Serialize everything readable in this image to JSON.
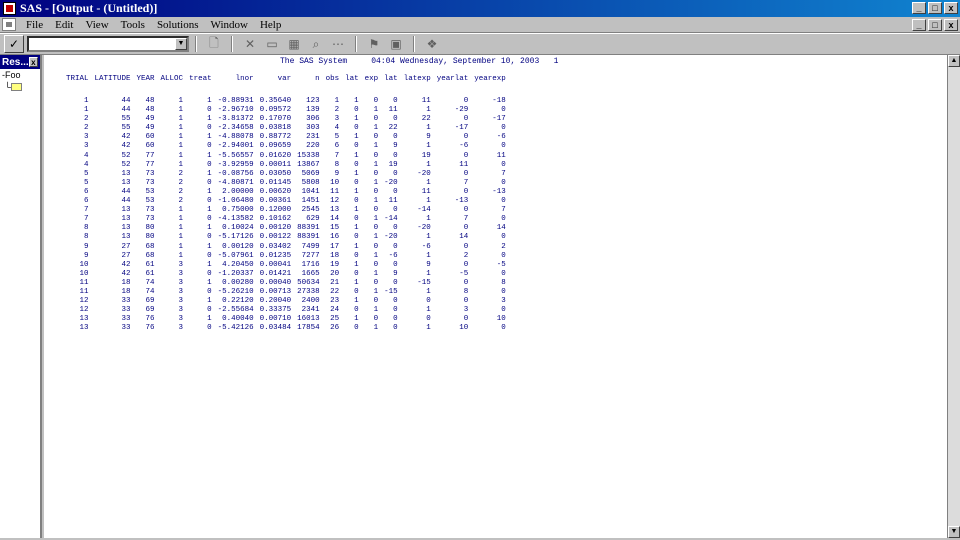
{
  "window": {
    "title": "SAS - [Output - (Untitled)]",
    "buttons": [
      "_",
      "□",
      "x"
    ]
  },
  "menu": {
    "items": [
      "File",
      "Edit",
      "View",
      "Tools",
      "Solutions",
      "Window",
      "Help"
    ],
    "mdi_buttons": [
      "_",
      "□",
      "x"
    ]
  },
  "toolbar": {
    "check_label": "✓",
    "command_value": ""
  },
  "results_pane": {
    "title": "Res...",
    "close": "x",
    "tree_item": "Foo"
  },
  "output": {
    "header": "The SAS System     04:04 Wednesday, September 10, 2003   1",
    "columns": [
      "TRIAL",
      "LATITUDE",
      "YEAR",
      "ALLOC",
      "treat",
      "lnor",
      "var",
      "n",
      "obs",
      "lat",
      "exp",
      "lat",
      "latexp",
      "yearlat",
      "yearexp"
    ],
    "rows": [
      [
        "1",
        "44",
        "48",
        "1",
        "1",
        "-0.88931",
        "0.35640",
        "123",
        "1",
        "1",
        "0",
        "0",
        "11",
        "0",
        "-18"
      ],
      [
        "1",
        "44",
        "48",
        "1",
        "0",
        "-2.96710",
        "0.09572",
        "139",
        "2",
        "0",
        "1",
        "11",
        "1",
        "-29",
        "0"
      ],
      [
        "2",
        "55",
        "49",
        "1",
        "1",
        "-3.81372",
        "0.17070",
        "306",
        "3",
        "1",
        "0",
        "0",
        "22",
        "0",
        "-17"
      ],
      [
        "2",
        "55",
        "49",
        "1",
        "0",
        "-2.34658",
        "0.03818",
        "303",
        "4",
        "0",
        "1",
        "22",
        "1",
        "-17",
        "0"
      ],
      [
        "3",
        "42",
        "60",
        "1",
        "1",
        "-4.88078",
        "0.88772",
        "231",
        "5",
        "1",
        "0",
        "0",
        "9",
        "0",
        "-6"
      ],
      [
        "3",
        "42",
        "60",
        "1",
        "0",
        "-2.94001",
        "0.09659",
        "220",
        "6",
        "0",
        "1",
        "9",
        "1",
        "-6",
        "0"
      ],
      [
        "4",
        "52",
        "77",
        "1",
        "1",
        "-5.56557",
        "0.01620",
        "15338",
        "7",
        "1",
        "0",
        "0",
        "19",
        "0",
        "11"
      ],
      [
        "4",
        "52",
        "77",
        "1",
        "0",
        "-3.92959",
        "0.00011",
        "13867",
        "8",
        "0",
        "1",
        "19",
        "1",
        "11",
        "0"
      ],
      [
        "5",
        "13",
        "73",
        "2",
        "1",
        "-0.08756",
        "0.03050",
        "5069",
        "9",
        "1",
        "0",
        "0",
        "-20",
        "0",
        "7"
      ],
      [
        "5",
        "13",
        "73",
        "2",
        "0",
        "-4.80871",
        "0.01145",
        "5808",
        "10",
        "0",
        "1",
        "-20",
        "1",
        "7",
        "0"
      ],
      [
        "6",
        "44",
        "53",
        "2",
        "1",
        "2.00000",
        "0.00620",
        "1041",
        "11",
        "1",
        "0",
        "0",
        "11",
        "0",
        "-13"
      ],
      [
        "6",
        "44",
        "53",
        "2",
        "0",
        "-1.06480",
        "0.00361",
        "1451",
        "12",
        "0",
        "1",
        "11",
        "1",
        "-13",
        "0"
      ],
      [
        "7",
        "13",
        "73",
        "1",
        "1",
        "0.75000",
        "0.12000",
        "2545",
        "13",
        "1",
        "0",
        "0",
        "-14",
        "0",
        "7"
      ],
      [
        "7",
        "13",
        "73",
        "1",
        "0",
        "-4.13582",
        "0.10162",
        "629",
        "14",
        "0",
        "1",
        "-14",
        "1",
        "7",
        "0"
      ],
      [
        "8",
        "13",
        "80",
        "1",
        "1",
        "0.10024",
        "0.00120",
        "88391",
        "15",
        "1",
        "0",
        "0",
        "-20",
        "0",
        "14"
      ],
      [
        "8",
        "13",
        "80",
        "1",
        "0",
        "-5.17126",
        "0.00122",
        "88391",
        "16",
        "0",
        "1",
        "-20",
        "1",
        "14",
        "0"
      ],
      [
        "9",
        "27",
        "68",
        "1",
        "1",
        "0.00120",
        "0.03402",
        "7499",
        "17",
        "1",
        "0",
        "0",
        "-6",
        "0",
        "2"
      ],
      [
        "9",
        "27",
        "68",
        "1",
        "0",
        "-5.07961",
        "0.01235",
        "7277",
        "18",
        "0",
        "1",
        "-6",
        "1",
        "2",
        "0"
      ],
      [
        "10",
        "42",
        "61",
        "3",
        "1",
        "4.20450",
        "0.00041",
        "1716",
        "19",
        "1",
        "0",
        "0",
        "9",
        "0",
        "-5"
      ],
      [
        "10",
        "42",
        "61",
        "3",
        "0",
        "-1.20337",
        "0.01421",
        "1665",
        "20",
        "0",
        "1",
        "9",
        "1",
        "-5",
        "0"
      ],
      [
        "11",
        "18",
        "74",
        "3",
        "1",
        "0.00280",
        "0.00040",
        "50634",
        "21",
        "1",
        "0",
        "0",
        "-15",
        "0",
        "8"
      ],
      [
        "11",
        "18",
        "74",
        "3",
        "0",
        "-5.26210",
        "0.00713",
        "27338",
        "22",
        "0",
        "1",
        "-15",
        "1",
        "8",
        "0"
      ],
      [
        "12",
        "33",
        "69",
        "3",
        "1",
        "0.22120",
        "0.20040",
        "2400",
        "23",
        "1",
        "0",
        "0",
        "0",
        "0",
        "3"
      ],
      [
        "12",
        "33",
        "69",
        "3",
        "0",
        "-2.55684",
        "0.33375",
        "2341",
        "24",
        "0",
        "1",
        "0",
        "1",
        "3",
        "0"
      ],
      [
        "13",
        "33",
        "76",
        "3",
        "1",
        "0.40040",
        "0.00710",
        "16013",
        "25",
        "1",
        "0",
        "0",
        "0",
        "0",
        "10"
      ],
      [
        "13",
        "33",
        "76",
        "3",
        "0",
        "-5.42126",
        "0.03484",
        "17854",
        "26",
        "0",
        "1",
        "0",
        "1",
        "10",
        "0"
      ]
    ]
  },
  "colors": {
    "title_start": "#000080",
    "title_end": "#1084d0",
    "output_text": "#000080",
    "chrome": "#c0c0c0"
  },
  "icons": [
    "sas-app-icon",
    "document-icon",
    "check-icon",
    "new-icon",
    "cut-icon",
    "copy-icon",
    "paste-icon",
    "find-icon",
    "submit-icon",
    "help-icon"
  ]
}
